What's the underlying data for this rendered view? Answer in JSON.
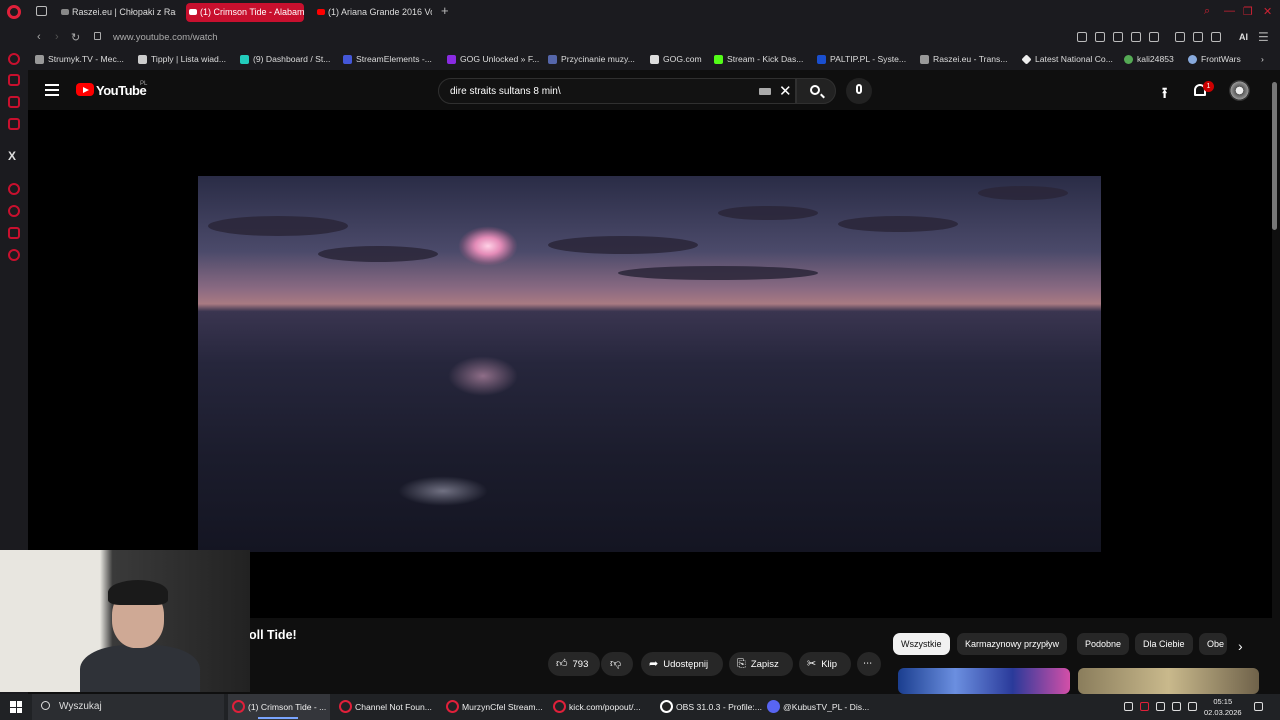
{
  "browser": {
    "tabs": [
      {
        "label": "Raszei.eu | Chłopaki z Ras",
        "active": false
      },
      {
        "label": "(1) Crimson Tide - Alabam",
        "active": true
      },
      {
        "label": "(1) Ariana Grande 2016 Vo",
        "active": false
      }
    ],
    "new_tab": "+",
    "url": "www.youtube.com/watch",
    "ai_label": "AI",
    "bookmarks": [
      "Strumyk.TV - Mec...",
      "Tipply | Lista wiad...",
      "(9) Dashboard / St...",
      "StreamElements -...",
      "GOG Unlocked » F...",
      "Przycinanie muzy...",
      "GOG.com",
      "Stream - Kick Das...",
      "PALTIP.PL - Syste...",
      "Raszei.eu - Trans...",
      "Latest National Co...",
      "kali24853",
      "FrontWars"
    ]
  },
  "youtube": {
    "logo_text": "YouTube",
    "region": "PL",
    "search_query": "dire straits sultans 8 min\\",
    "notification_count": "1",
    "video_title": "oll Tide!",
    "like_count": "793",
    "actions": {
      "share": "Udostępnij",
      "save": "Zapisz",
      "clip": "Klip",
      "more": "⋯"
    },
    "chips": [
      "Wszystkie",
      "Karmazynowy przypływ",
      "Podobne",
      "Dla Ciebie",
      "Obe"
    ]
  },
  "taskbar": {
    "search_placeholder": "Wyszukaj",
    "apps": [
      "(1) Crimson Tide - ...",
      "Channel Not Foun...",
      "MurzynCfel Stream...",
      "kick.com/popout/...",
      "OBS 31.0.3 - Profile:...",
      "@KubusTV_PL - Dis..."
    ],
    "time": "05:15",
    "date": "02.03.2026"
  },
  "colors": {
    "accent_red": "#c8102e",
    "youtube_red": "#ff0000",
    "background": "#0f0f0f"
  }
}
